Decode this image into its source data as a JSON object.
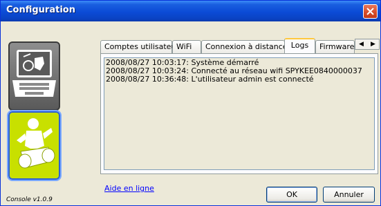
{
  "window": {
    "title": "Configuration"
  },
  "sidebar": {
    "tiles": [
      {
        "icon": "laptop-robot-icon",
        "selected": false
      },
      {
        "icon": "robot-icon",
        "selected": true
      }
    ]
  },
  "tabs": [
    {
      "label": "Comptes utilisateurs",
      "active": false
    },
    {
      "label": "WiFi",
      "active": false
    },
    {
      "label": "Connexion à distance",
      "active": false
    },
    {
      "label": "Logs",
      "active": true
    },
    {
      "label": "Firmware",
      "active": false
    }
  ],
  "tab_scroll": {
    "left": "◀",
    "right": "▶"
  },
  "logs": [
    "2008/08/27 10:03:17: Système démarré",
    "2008/08/27 10:03:24: Connecté au réseau wifi SPYKEE0840000037",
    "2008/08/27 10:36:48: L'utilisateur admin est connecté"
  ],
  "footer": {
    "help_link": "Aide en ligne",
    "ok_label": "OK",
    "cancel_label": "Annuler",
    "version": "Console v1.0.9"
  },
  "colors": {
    "titlebar": "#0b4bd6",
    "robot_tile": "#c8e000",
    "close": "#d54a27"
  }
}
